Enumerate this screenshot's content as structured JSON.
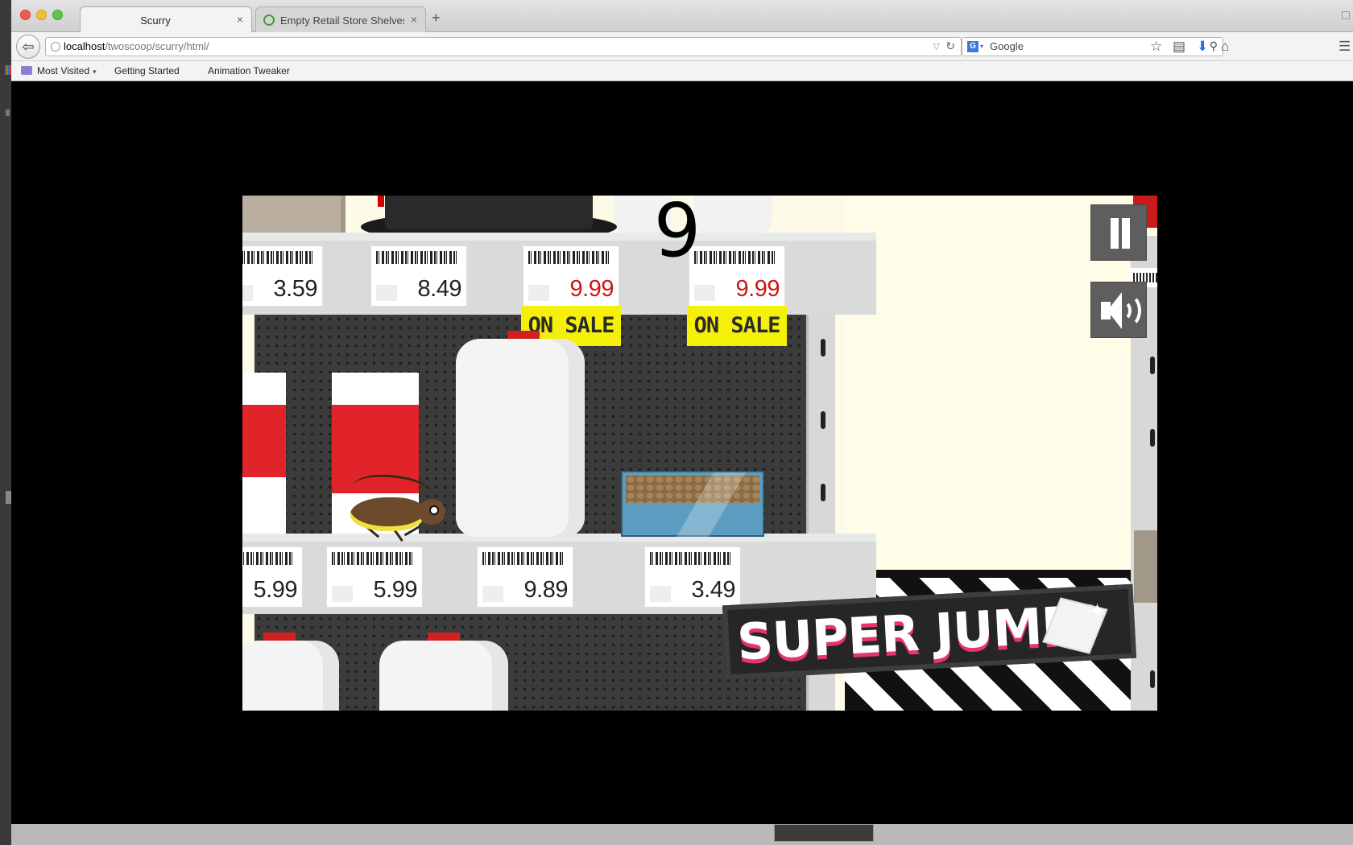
{
  "browser": {
    "tabs": [
      {
        "title": "Scurry",
        "active": true
      },
      {
        "title": "Empty Retail Store Shelves...",
        "active": false
      }
    ],
    "url": {
      "host": "localhost",
      "path": "/twoscoop/scurry/html/"
    },
    "search": {
      "engine": "G",
      "placeholder": "Google"
    },
    "bookmarks": [
      "Most Visited",
      "Getting Started",
      "Animation Tweaker"
    ]
  },
  "icons": {
    "close": "×",
    "newtab": "+",
    "back": "⇦",
    "reload": "↻",
    "dropdown": "▽",
    "caret": "▾",
    "search": "⚲",
    "star": "☆",
    "reading_list": "▤",
    "download": "⬇",
    "home": "⌂",
    "menu": "☰",
    "spark": "✦"
  },
  "game": {
    "score": "9",
    "top_shelf_prices": [
      {
        "price": "3.59",
        "sale": false
      },
      {
        "price": "8.49",
        "sale": false
      },
      {
        "price": "9.99",
        "sale": true
      },
      {
        "price": "9.99",
        "sale": true
      }
    ],
    "on_sale_label": "ON SALE",
    "mid_shelf_prices": [
      "5.99",
      "5.99",
      "9.89",
      "3.49"
    ],
    "powerup_banner": "SUPER JUMP!",
    "colors": {
      "sale_price": "#d01515",
      "on_sale_tag": "#f5f00a",
      "carton_red": "#e0242a",
      "banner_shadow": "#e8356a"
    }
  }
}
